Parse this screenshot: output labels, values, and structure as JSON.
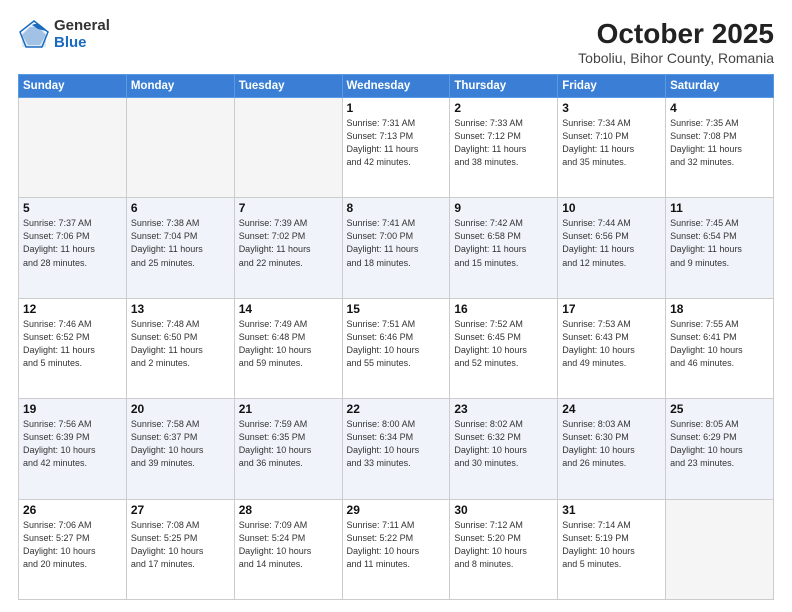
{
  "logo": {
    "general": "General",
    "blue": "Blue"
  },
  "header": {
    "month": "October 2025",
    "location": "Toboliu, Bihor County, Romania"
  },
  "weekdays": [
    "Sunday",
    "Monday",
    "Tuesday",
    "Wednesday",
    "Thursday",
    "Friday",
    "Saturday"
  ],
  "weeks": [
    [
      {
        "day": "",
        "info": ""
      },
      {
        "day": "",
        "info": ""
      },
      {
        "day": "",
        "info": ""
      },
      {
        "day": "1",
        "info": "Sunrise: 7:31 AM\nSunset: 7:13 PM\nDaylight: 11 hours\nand 42 minutes."
      },
      {
        "day": "2",
        "info": "Sunrise: 7:33 AM\nSunset: 7:12 PM\nDaylight: 11 hours\nand 38 minutes."
      },
      {
        "day": "3",
        "info": "Sunrise: 7:34 AM\nSunset: 7:10 PM\nDaylight: 11 hours\nand 35 minutes."
      },
      {
        "day": "4",
        "info": "Sunrise: 7:35 AM\nSunset: 7:08 PM\nDaylight: 11 hours\nand 32 minutes."
      }
    ],
    [
      {
        "day": "5",
        "info": "Sunrise: 7:37 AM\nSunset: 7:06 PM\nDaylight: 11 hours\nand 28 minutes."
      },
      {
        "day": "6",
        "info": "Sunrise: 7:38 AM\nSunset: 7:04 PM\nDaylight: 11 hours\nand 25 minutes."
      },
      {
        "day": "7",
        "info": "Sunrise: 7:39 AM\nSunset: 7:02 PM\nDaylight: 11 hours\nand 22 minutes."
      },
      {
        "day": "8",
        "info": "Sunrise: 7:41 AM\nSunset: 7:00 PM\nDaylight: 11 hours\nand 18 minutes."
      },
      {
        "day": "9",
        "info": "Sunrise: 7:42 AM\nSunset: 6:58 PM\nDaylight: 11 hours\nand 15 minutes."
      },
      {
        "day": "10",
        "info": "Sunrise: 7:44 AM\nSunset: 6:56 PM\nDaylight: 11 hours\nand 12 minutes."
      },
      {
        "day": "11",
        "info": "Sunrise: 7:45 AM\nSunset: 6:54 PM\nDaylight: 11 hours\nand 9 minutes."
      }
    ],
    [
      {
        "day": "12",
        "info": "Sunrise: 7:46 AM\nSunset: 6:52 PM\nDaylight: 11 hours\nand 5 minutes."
      },
      {
        "day": "13",
        "info": "Sunrise: 7:48 AM\nSunset: 6:50 PM\nDaylight: 11 hours\nand 2 minutes."
      },
      {
        "day": "14",
        "info": "Sunrise: 7:49 AM\nSunset: 6:48 PM\nDaylight: 10 hours\nand 59 minutes."
      },
      {
        "day": "15",
        "info": "Sunrise: 7:51 AM\nSunset: 6:46 PM\nDaylight: 10 hours\nand 55 minutes."
      },
      {
        "day": "16",
        "info": "Sunrise: 7:52 AM\nSunset: 6:45 PM\nDaylight: 10 hours\nand 52 minutes."
      },
      {
        "day": "17",
        "info": "Sunrise: 7:53 AM\nSunset: 6:43 PM\nDaylight: 10 hours\nand 49 minutes."
      },
      {
        "day": "18",
        "info": "Sunrise: 7:55 AM\nSunset: 6:41 PM\nDaylight: 10 hours\nand 46 minutes."
      }
    ],
    [
      {
        "day": "19",
        "info": "Sunrise: 7:56 AM\nSunset: 6:39 PM\nDaylight: 10 hours\nand 42 minutes."
      },
      {
        "day": "20",
        "info": "Sunrise: 7:58 AM\nSunset: 6:37 PM\nDaylight: 10 hours\nand 39 minutes."
      },
      {
        "day": "21",
        "info": "Sunrise: 7:59 AM\nSunset: 6:35 PM\nDaylight: 10 hours\nand 36 minutes."
      },
      {
        "day": "22",
        "info": "Sunrise: 8:00 AM\nSunset: 6:34 PM\nDaylight: 10 hours\nand 33 minutes."
      },
      {
        "day": "23",
        "info": "Sunrise: 8:02 AM\nSunset: 6:32 PM\nDaylight: 10 hours\nand 30 minutes."
      },
      {
        "day": "24",
        "info": "Sunrise: 8:03 AM\nSunset: 6:30 PM\nDaylight: 10 hours\nand 26 minutes."
      },
      {
        "day": "25",
        "info": "Sunrise: 8:05 AM\nSunset: 6:29 PM\nDaylight: 10 hours\nand 23 minutes."
      }
    ],
    [
      {
        "day": "26",
        "info": "Sunrise: 7:06 AM\nSunset: 5:27 PM\nDaylight: 10 hours\nand 20 minutes."
      },
      {
        "day": "27",
        "info": "Sunrise: 7:08 AM\nSunset: 5:25 PM\nDaylight: 10 hours\nand 17 minutes."
      },
      {
        "day": "28",
        "info": "Sunrise: 7:09 AM\nSunset: 5:24 PM\nDaylight: 10 hours\nand 14 minutes."
      },
      {
        "day": "29",
        "info": "Sunrise: 7:11 AM\nSunset: 5:22 PM\nDaylight: 10 hours\nand 11 minutes."
      },
      {
        "day": "30",
        "info": "Sunrise: 7:12 AM\nSunset: 5:20 PM\nDaylight: 10 hours\nand 8 minutes."
      },
      {
        "day": "31",
        "info": "Sunrise: 7:14 AM\nSunset: 5:19 PM\nDaylight: 10 hours\nand 5 minutes."
      },
      {
        "day": "",
        "info": ""
      }
    ]
  ]
}
